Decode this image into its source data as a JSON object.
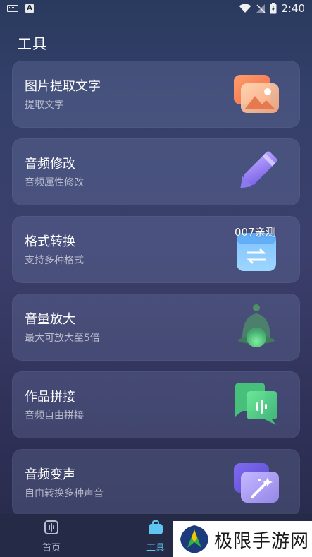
{
  "status_bar": {
    "time": "2:40"
  },
  "page": {
    "title": "工具"
  },
  "cards": [
    {
      "title": "图片提取文字",
      "subtitle": "提取文字",
      "icon": "image-icon"
    },
    {
      "title": "音频修改",
      "subtitle": "音频属性修改",
      "icon": "pencil-icon"
    },
    {
      "title": "格式转换",
      "subtitle": "支持多种格式",
      "icon": "swap-icon",
      "overlay_text": "007亲测"
    },
    {
      "title": "音量放大",
      "subtitle": "最大可放大至5倍",
      "icon": "bell-icon"
    },
    {
      "title": "作品拼接",
      "subtitle": "音频自由拼接",
      "icon": "chat-audio-icon"
    },
    {
      "title": "音频变声",
      "subtitle": "自由转换多种声音",
      "icon": "magic-wand-icon"
    }
  ],
  "nav": {
    "home_label": "首页",
    "tools_label": "工具",
    "active_color": "#5ec6f0",
    "inactive_color": "#b6bed2"
  },
  "watermark": {
    "brand": "极限手游网"
  }
}
